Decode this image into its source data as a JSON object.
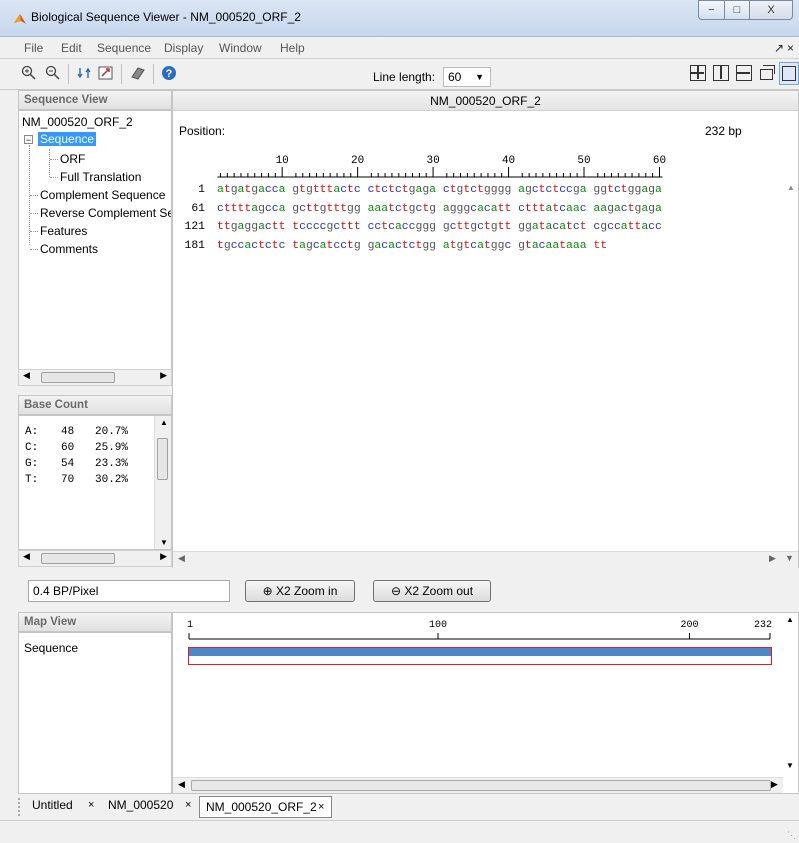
{
  "window": {
    "title": "Biological Sequence Viewer - NM_000520_ORF_2",
    "minimize_glyph": "−",
    "maximize_glyph": "□",
    "close_glyph": "X"
  },
  "menu": {
    "items": [
      "File",
      "Edit",
      "Sequence",
      "Display",
      "Window",
      "Help"
    ],
    "undock_glyph": "↗",
    "close_glyph": "×"
  },
  "toolbar": {
    "icons": [
      "zoom-in-icon",
      "zoom-out-icon",
      "swap-icon",
      "export-icon",
      "eraser-icon",
      "help-icon"
    ],
    "line_length_label": "Line length:",
    "line_length_value": "60",
    "layouts": [
      "grid-4-layout-icon",
      "split-vertical-layout-icon",
      "split-horizontal-layout-icon",
      "float-layout-icon",
      "single-layout-icon"
    ]
  },
  "sequence_view": {
    "header": "Sequence View",
    "root": "NM_000520_ORF_2",
    "selected": "Sequence",
    "children": [
      "ORF",
      "Full Translation"
    ],
    "others": [
      "Complement Sequence",
      "Reverse Complement Se",
      "Features",
      "Comments"
    ]
  },
  "base_count": {
    "header": "Base Count",
    "rows": [
      {
        "base": "A:",
        "count": "48",
        "pct": "20.7%"
      },
      {
        "base": "C:",
        "count": "60",
        "pct": "25.9%"
      },
      {
        "base": "G:",
        "count": "54",
        "pct": "23.3%"
      },
      {
        "base": "T:",
        "count": "70",
        "pct": "30.2%"
      }
    ]
  },
  "main": {
    "title": "NM_000520_ORF_2",
    "position_label": "Position:",
    "length": "232 bp",
    "ruler_labels": [
      "10",
      "20",
      "30",
      "40",
      "50",
      "60"
    ],
    "rows": [
      {
        "num": "1",
        "seq": "atgatgacca gtgtttactc ctctctgaga ctgtctgggg agctctccga ggtctggaga"
      },
      {
        "num": "61",
        "seq": "cttttagcca gcttgtttgg aaatctgctg agggcacatt ctttatcaac aagactgaga"
      },
      {
        "num": "121",
        "seq": "ttgaggactt tccccgcttt cctcaccggg gcttgctgtt ggatacatct cgccattacc"
      },
      {
        "num": "181",
        "seq": "tgccactctc tagcatcctg gacactctgg atgtcatggc gtacaataaa tt"
      }
    ],
    "base_colors": {
      "a": "#0a8a0a",
      "c": "#1f2fd6",
      "g": "#555555",
      "t": "#d41010"
    }
  },
  "zoom": {
    "scale": "0.4 BP/Pixel",
    "zoom_in": "X2 Zoom in",
    "zoom_out": "X2 Zoom out"
  },
  "map_view": {
    "header": "Map View",
    "track": "Sequence",
    "ruler": [
      "1",
      "100",
      "200",
      "232"
    ],
    "bar_color": "#4f86c6",
    "outline_color": "#e02020"
  },
  "tabs": [
    {
      "label": "Untitled",
      "close": "×"
    },
    {
      "label": "NM_000520",
      "close": "×"
    },
    {
      "label": "NM_000520_ORF_2",
      "close": "×"
    }
  ]
}
